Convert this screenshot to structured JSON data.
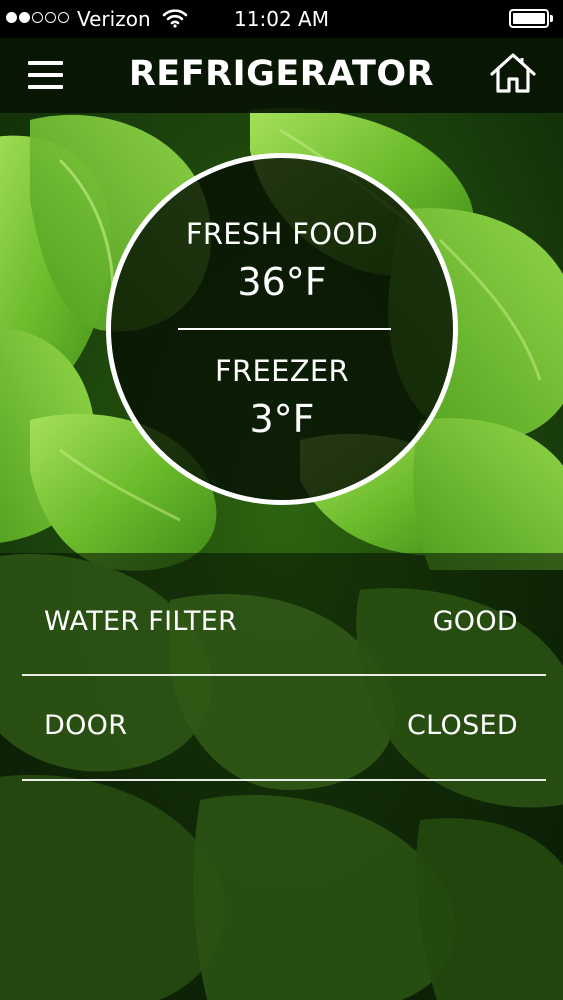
{
  "status_bar": {
    "carrier": "Verizon",
    "time": "11:02 AM",
    "signal_strength_of_5": 2,
    "icons": [
      "wifi-icon",
      "battery-icon"
    ]
  },
  "nav": {
    "title": "REFRIGERATOR",
    "left_icon": "menu-icon",
    "right_icon": "home-icon"
  },
  "temperatures": {
    "fresh_food": {
      "label": "FRESH FOOD",
      "value": "36°F"
    },
    "freezer": {
      "label": "FREEZER",
      "value": "3°F"
    }
  },
  "status_rows": [
    {
      "label": "WATER FILTER",
      "value": "GOOD"
    },
    {
      "label": "DOOR",
      "value": "CLOSED"
    }
  ],
  "colors": {
    "leaf_green": "#7cc83a",
    "text": "#ffffff",
    "bar": "#000000"
  }
}
